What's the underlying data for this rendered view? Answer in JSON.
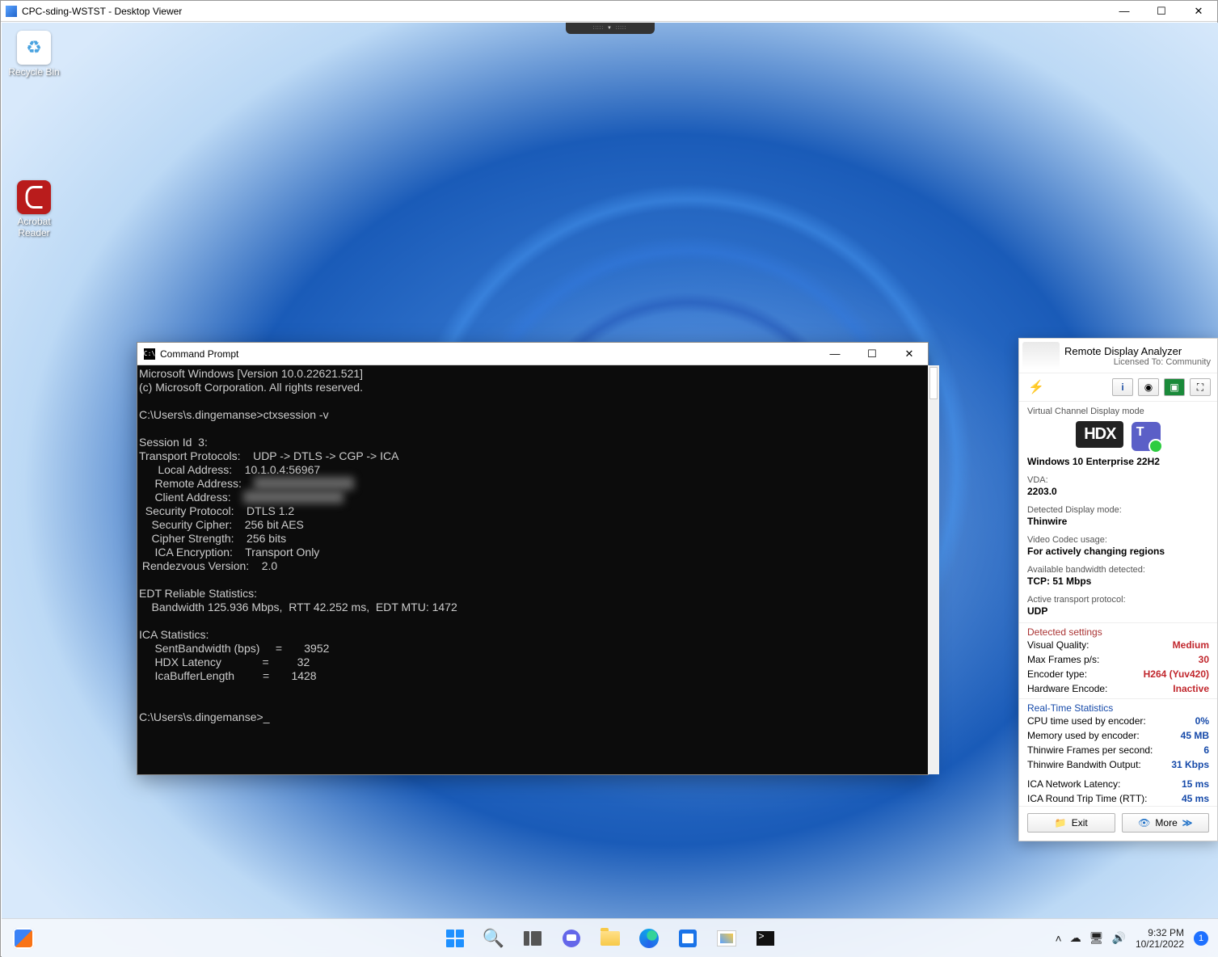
{
  "outerWindow": {
    "title": "CPC-sding-WSTST - Desktop Viewer"
  },
  "desktopIcons": {
    "recycle": "Recycle Bin",
    "reader": "Acrobat Reader"
  },
  "cmd": {
    "title": "Command Prompt",
    "lines": {
      "l1": "Microsoft Windows [Version 10.0.22621.521]",
      "l2": "(c) Microsoft Corporation. All rights reserved.",
      "l3": "",
      "l4": "C:\\Users\\s.dingemanse>ctxsession -v",
      "l5": "",
      "l6": "Session Id  3:",
      "l7": "Transport Protocols:    UDP -> DTLS -> CGP -> ICA",
      "l8": "      Local Address:    10.1.0.4:56967",
      "l9p": "     Remote Address:    ",
      "l10p": "     Client Address:    ",
      "l11": "  Security Protocol:    DTLS 1.2",
      "l12": "    Security Cipher:    256 bit AES",
      "l13": "    Cipher Strength:    256 bits",
      "l14": "     ICA Encryption:    Transport Only",
      "l15": " Rendezvous Version:    2.0",
      "l16": "",
      "l17": "EDT Reliable Statistics:",
      "l18": "    Bandwidth 125.936 Mbps,  RTT 42.252 ms,  EDT MTU: 1472",
      "l19": "",
      "l20": "ICA Statistics:",
      "l21": "     SentBandwidth (bps)     =       3952",
      "l22": "     HDX Latency             =         32",
      "l23": "     IcaBufferLength         =       1428",
      "l24": "",
      "l25": "",
      "l26": "C:\\Users\\s.dingemanse>"
    }
  },
  "rda": {
    "title": "Remote Display Analyzer",
    "subtitle": "Licensed To: Community",
    "channelMode": "Virtual Channel Display mode",
    "hdx": "HDX",
    "os": "Windows 10 Enterprise 22H2",
    "vdaLabel": "VDA:",
    "vda": "2203.0",
    "dispModeLabel": "Detected Display mode:",
    "dispMode": "Thinwire",
    "codecUseLabel": "Video Codec usage:",
    "codecUse": "For actively changing regions",
    "bwLabel": "Available bandwidth detected:",
    "bw": "TCP: 51 Mbps",
    "transLabel": "Active transport protocol:",
    "trans": "UDP",
    "detectedHeader": "Detected settings",
    "vqLabel": "Visual Quality:",
    "vq": "Medium",
    "fpsLabel": "Max Frames p/s:",
    "fps": "30",
    "encLabel": "Encoder type:",
    "enc": "H264 (Yuv420)",
    "hweLabel": "Hardware Encode:",
    "hwe": "Inactive",
    "rtHeader": "Real-Time Statistics",
    "cpuLabel": "CPU time used by encoder:",
    "cpu": "0%",
    "memLabel": "Memory used by encoder:",
    "mem": "45 MB",
    "tfpsLabel": "Thinwire Frames per second:",
    "tfps": "6",
    "tbwLabel": "Thinwire Bandwith Output:",
    "tbw": "31 Kbps",
    "latLabel": "ICA Network Latency:",
    "lat": "15 ms",
    "rttLabel": "ICA Round Trip Time (RTT):",
    "rtt": "45 ms",
    "exit": "Exit",
    "more": "More"
  },
  "taskbar": {
    "clock": {
      "time": "9:32 PM",
      "date": "10/21/2022"
    },
    "notifCount": "1"
  }
}
